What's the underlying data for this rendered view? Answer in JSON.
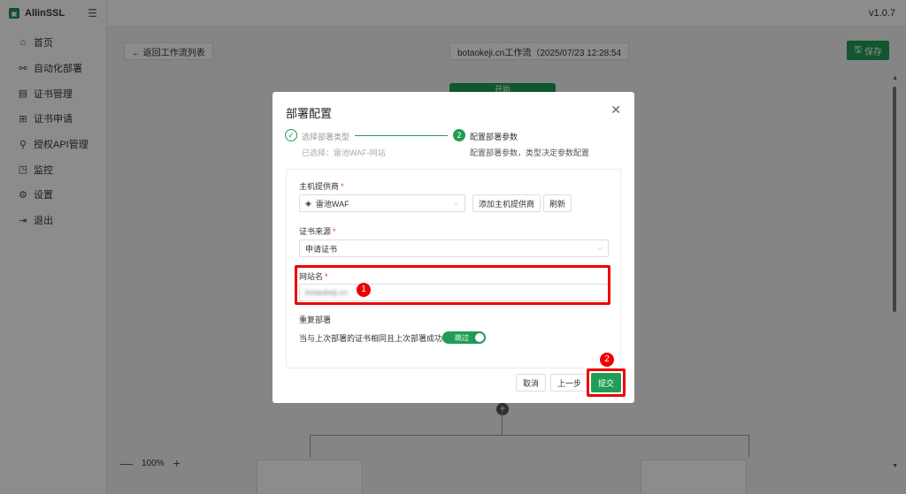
{
  "app": {
    "brand": "AllinSSL",
    "version": "v1.0.7"
  },
  "sidebar": {
    "items": [
      {
        "label": "首页",
        "icon": "home-icon",
        "glyph": "⌂"
      },
      {
        "label": "自动化部署",
        "icon": "workflow-icon",
        "glyph": "⚯"
      },
      {
        "label": "证书管理",
        "icon": "certificate-icon",
        "glyph": "▤"
      },
      {
        "label": "证书申请",
        "icon": "add-certificate-icon",
        "glyph": "⊞"
      },
      {
        "label": "授权API管理",
        "icon": "api-key-icon",
        "glyph": "⚲"
      },
      {
        "label": "监控",
        "icon": "monitor-icon",
        "glyph": "◳"
      },
      {
        "label": "设置",
        "icon": "gear-icon",
        "glyph": "⚙"
      },
      {
        "label": "退出",
        "icon": "logout-icon",
        "glyph": "⇥"
      }
    ]
  },
  "workflow": {
    "back_label": "← 返回工作流列表",
    "title": "botaokeji.cn工作流（2025/07/23 12:28:54",
    "save_label": "保存",
    "start_label": "开始",
    "zoom_out": "—",
    "zoom_level": "100%",
    "zoom_in": "+"
  },
  "modal": {
    "title": "部署配置",
    "close_glyph": "✕",
    "steps": [
      {
        "label": "选择部署类型",
        "desc": "已选择：雷池WAF-网站",
        "glyph": "✓"
      },
      {
        "label": "配置部署参数",
        "desc": "配置部署参数，类型决定参数配置",
        "glyph": "2"
      }
    ],
    "provider": {
      "label": "主机提供商",
      "required": "*",
      "value": "雷池WAF",
      "add_button": "添加主机提供商",
      "refresh_button": "刷新"
    },
    "cert_source": {
      "label": "证书来源",
      "required": "*",
      "value": "申请证书"
    },
    "site_name": {
      "label": "网站名",
      "required": "*",
      "value": "botaokeji.cn"
    },
    "redeploy": {
      "label": "重复部署",
      "description": "当与上次部署的证书相同且上次部署成功时",
      "toggle_label": "跳过"
    },
    "footer": {
      "cancel": "取消",
      "prev": "上一步",
      "submit": "提交"
    }
  },
  "annotations": {
    "badge1": "1",
    "badge2": "2",
    "highlight_color": "#e00000"
  },
  "colors": {
    "primary": "#1f9d55"
  }
}
